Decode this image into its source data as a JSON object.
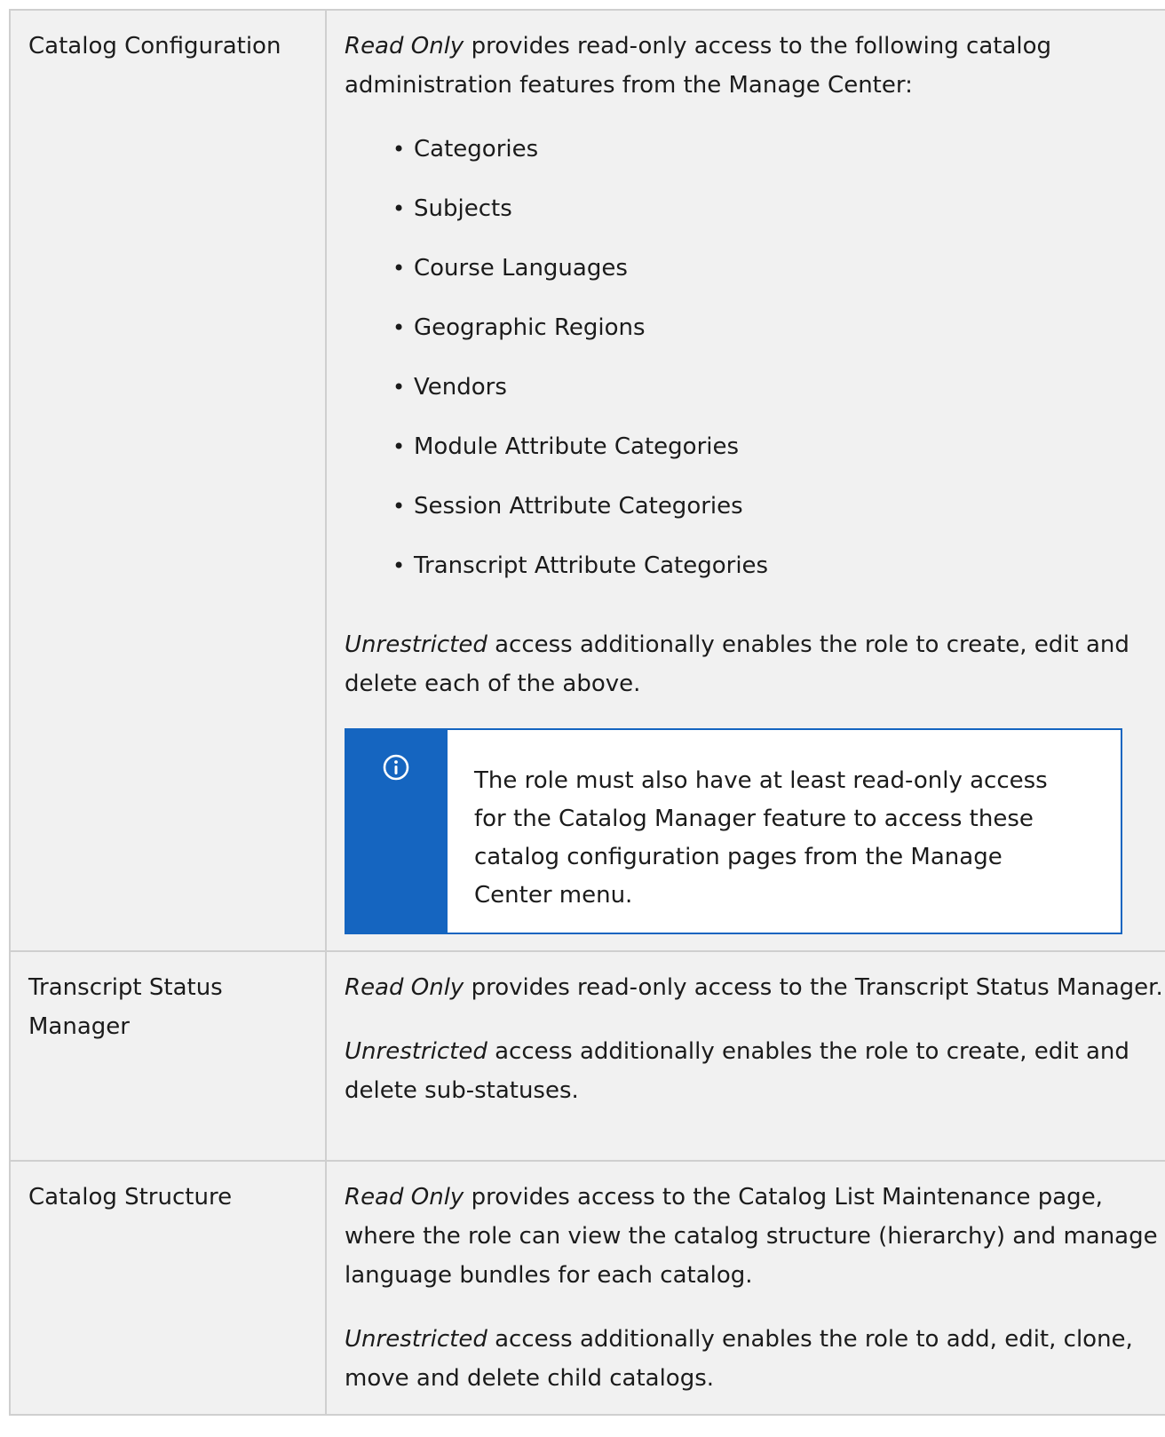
{
  "rows": [
    {
      "feature": "Catalog Configuration",
      "read_only_term": "Read Only",
      "read_only_text": " provides read-only access to the following catalog administration features from the Manage Center:",
      "items": [
        "Categories",
        "Subjects",
        "Course Languages",
        "Geographic Regions",
        "Vendors",
        "Module Attribute Categories",
        "Session Attribute Categories",
        "Transcript Attribute Categories"
      ],
      "unrestricted_term": "Unrestricted",
      "unrestricted_text": " access additionally enables the role to create, edit and delete each of the above.",
      "note": {
        "icon": "info-icon",
        "text": "The role must also have at least read-only access for the Catalog Manager feature to access these catalog configuration pages from the Manage Center menu."
      }
    },
    {
      "feature": "Transcript Status Manager",
      "read_only_term": "Read Only",
      "read_only_text": " provides read-only access to the Transcript Status Manager.",
      "unrestricted_term": "Unrestricted",
      "unrestricted_text": " access additionally enables the role to create, edit and delete sub-statuses."
    },
    {
      "feature": "Catalog Structure",
      "read_only_term": "Read Only",
      "read_only_text": " provides access to the Catalog List Maintenance page, where the role can view the catalog structure (hierarchy) and manage language bundles for each catalog.",
      "unrestricted_term": "Unrestricted",
      "unrestricted_text": " access additionally enables the role to add, edit, clone, move and delete child catalogs."
    }
  ],
  "colors": {
    "cell_bg": "#f1f1f1",
    "border": "#cfcfcf",
    "note_accent": "#1565c0"
  }
}
